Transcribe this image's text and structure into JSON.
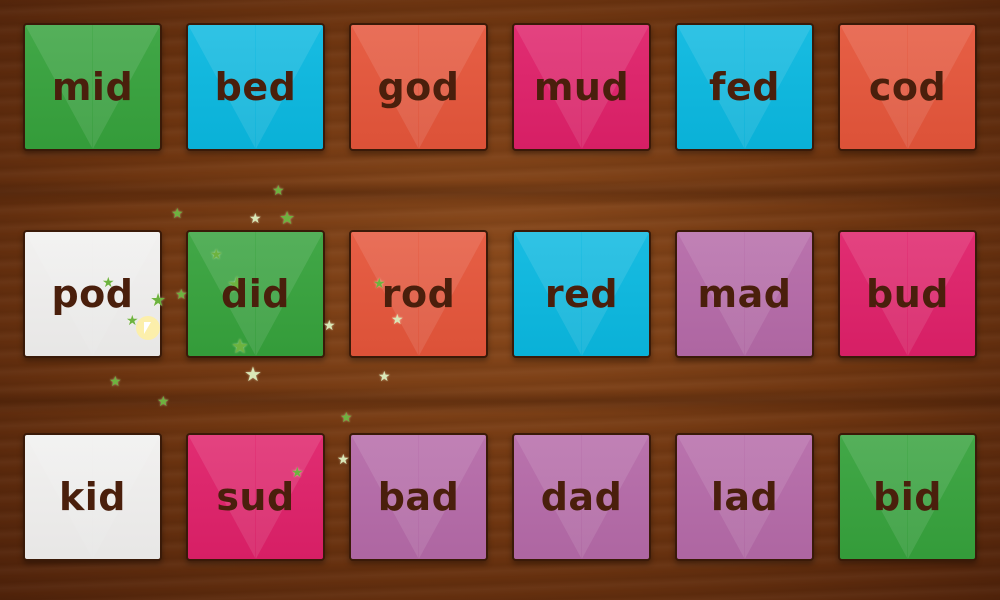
{
  "game": {
    "tiles": [
      {
        "word": "mid",
        "color": "green"
      },
      {
        "word": "bed",
        "color": "blue"
      },
      {
        "word": "god",
        "color": "orange"
      },
      {
        "word": "mud",
        "color": "pink"
      },
      {
        "word": "fed",
        "color": "blue"
      },
      {
        "word": "cod",
        "color": "orange"
      },
      {
        "word": "pod",
        "color": "white"
      },
      {
        "word": "did",
        "color": "green"
      },
      {
        "word": "rod",
        "color": "orange"
      },
      {
        "word": "red",
        "color": "blue"
      },
      {
        "word": "mad",
        "color": "purple"
      },
      {
        "word": "bud",
        "color": "pink"
      },
      {
        "word": "kid",
        "color": "white"
      },
      {
        "word": "sud",
        "color": "pink"
      },
      {
        "word": "bad",
        "color": "purple"
      },
      {
        "word": "dad",
        "color": "purple"
      },
      {
        "word": "lad",
        "color": "purple"
      },
      {
        "word": "bid",
        "color": "green"
      }
    ],
    "colors": {
      "green": "#36a23c",
      "blue": "#0ab8e0",
      "orange": "#e5553a",
      "pink": "#df2069",
      "purple": "#b56aa8",
      "white": "#f1f0ef",
      "text": "#4a1f0c",
      "wood": "#6e3510"
    },
    "effect_icon": "sparkle-star-icon",
    "pointer_icon": "mouse-pointer-icon"
  }
}
